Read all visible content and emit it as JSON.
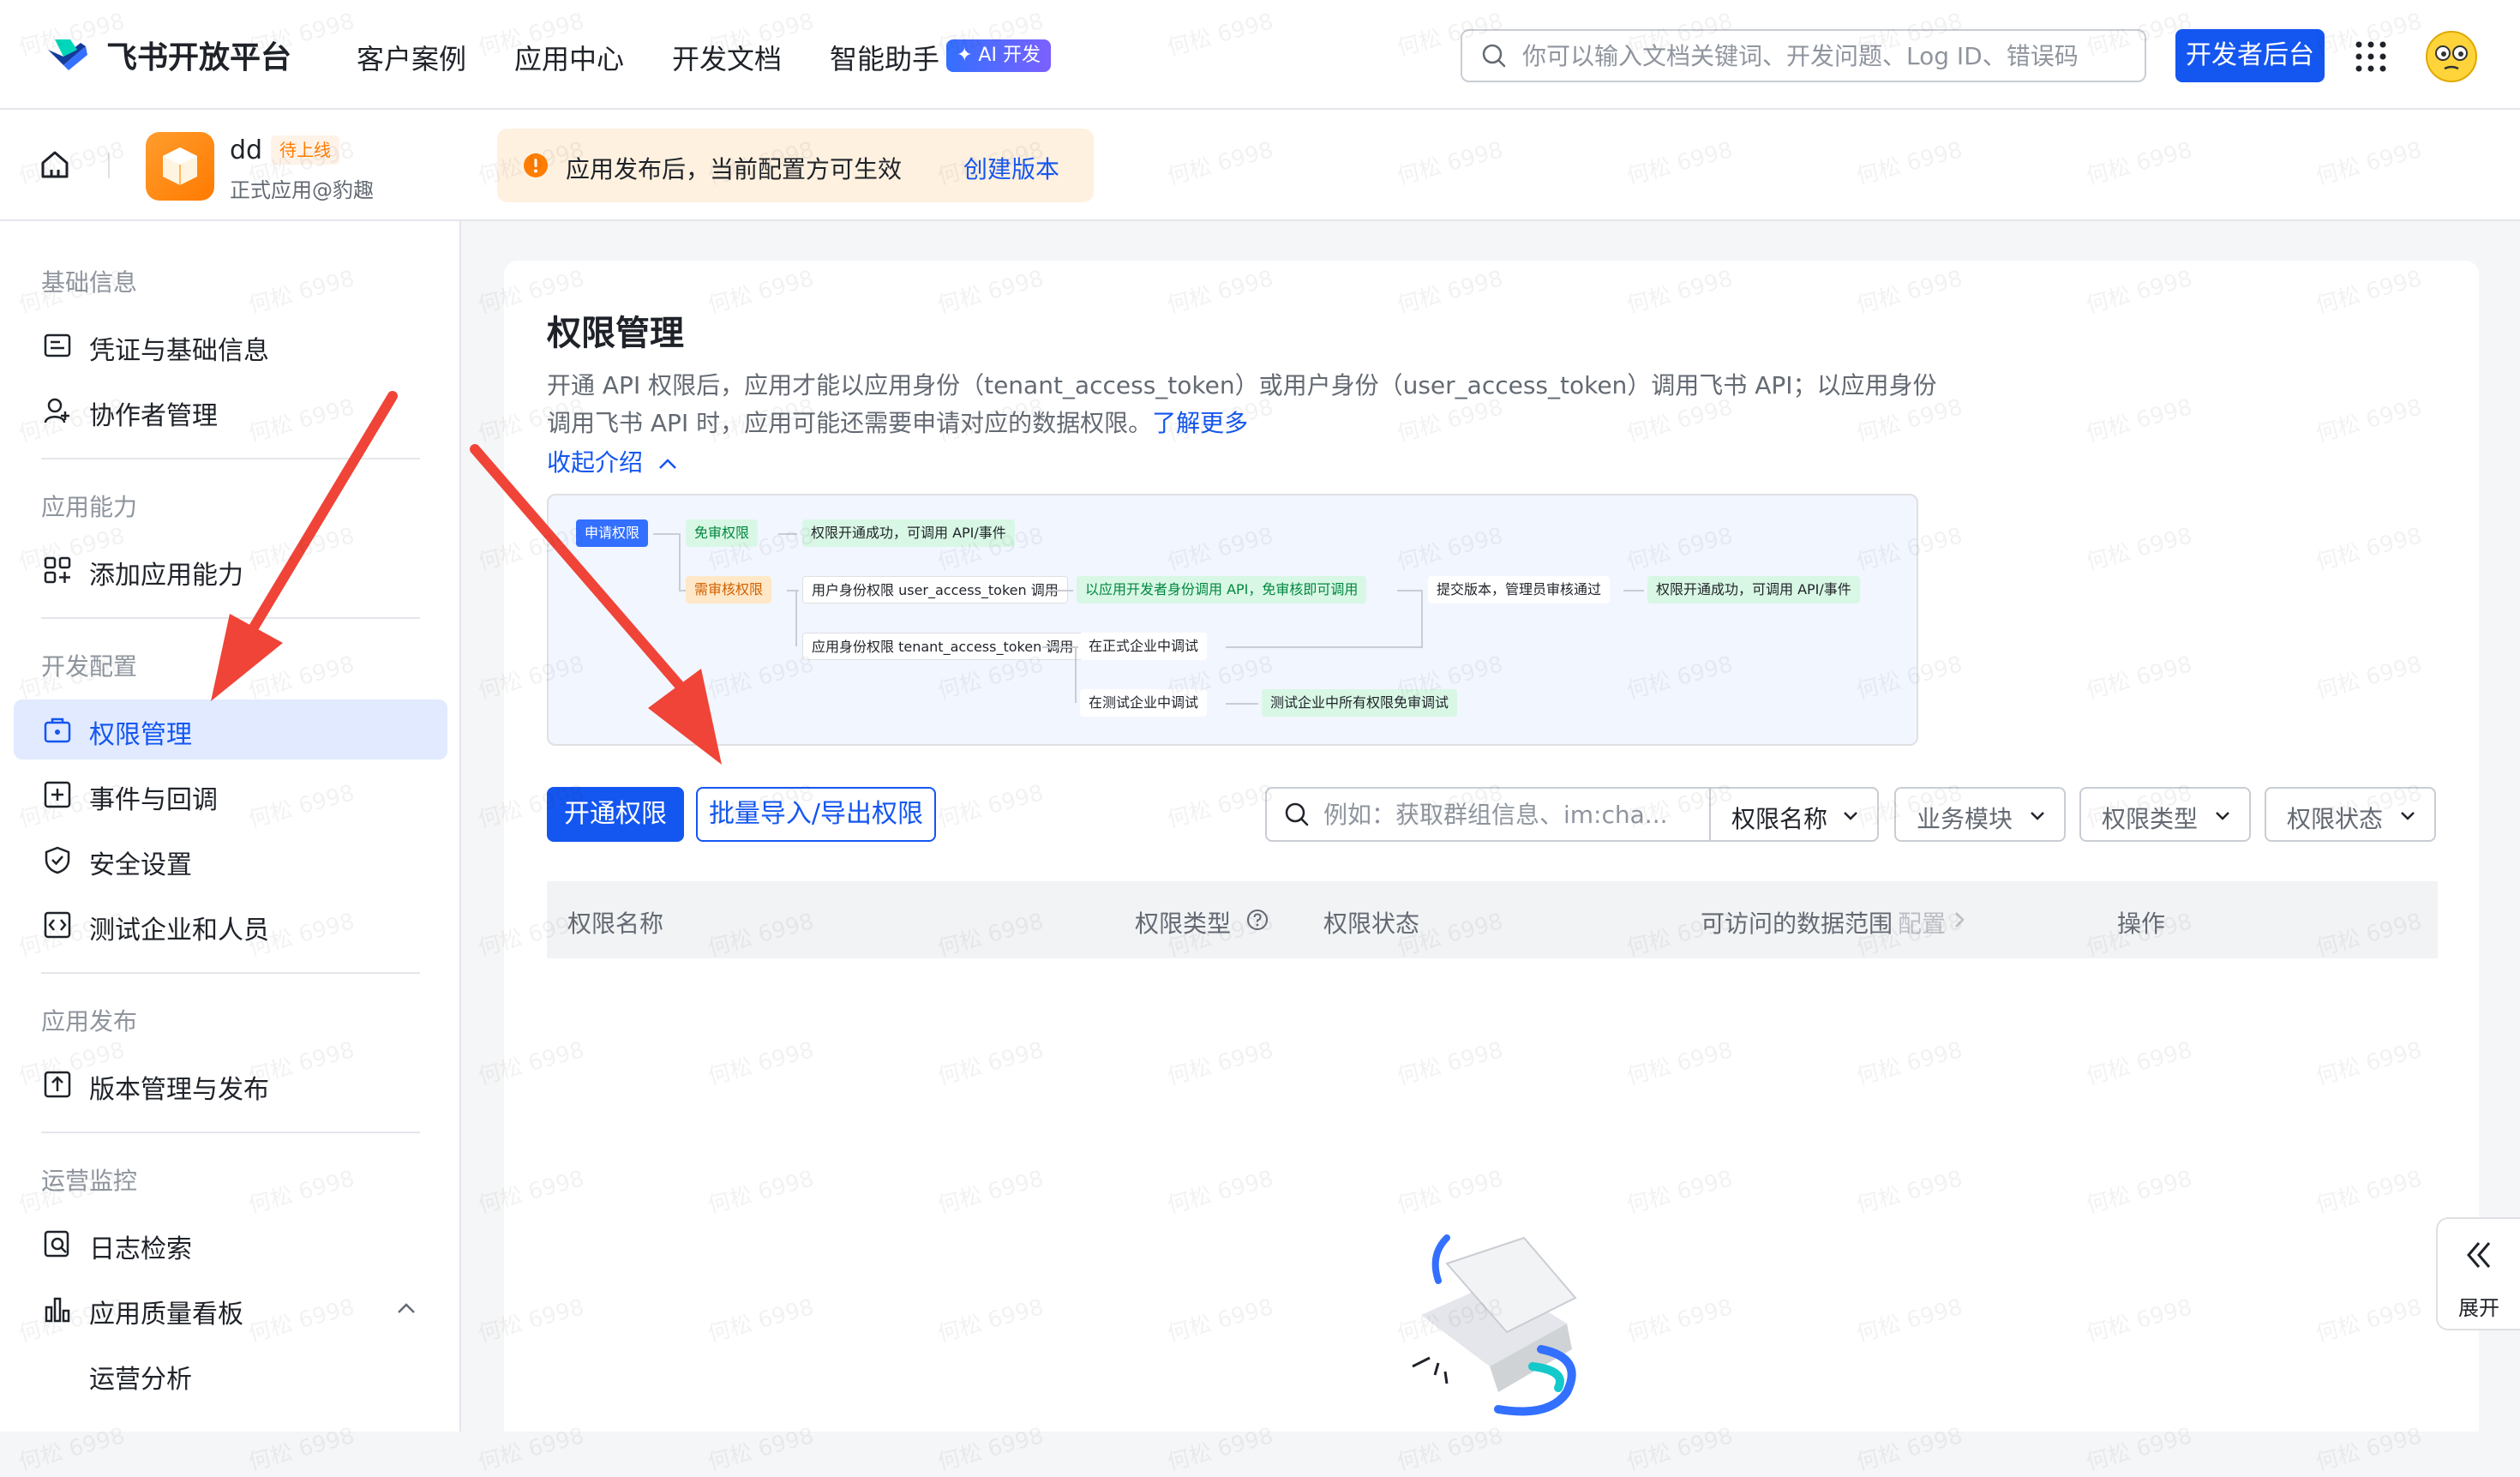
{
  "brand": {
    "name": "飞书开放平台"
  },
  "nav": {
    "items": [
      "客户案例",
      "应用中心",
      "开发文档",
      "智能助手"
    ],
    "ai_badge": "✦ AI 开发"
  },
  "search": {
    "placeholder": "你可以输入文档关键词、开发问题、Log ID、错误码"
  },
  "dev_button": "开发者后台",
  "app": {
    "name": "dd",
    "status": "待上线",
    "subtitle": "正式应用@豹趣"
  },
  "notice": {
    "text": "应用发布后，当前配置方可生效",
    "link": "创建版本"
  },
  "sidebar": {
    "sections": [
      {
        "title": "基础信息",
        "items": [
          {
            "label": "凭证与基础信息",
            "icon": "credential-icon"
          },
          {
            "label": "协作者管理",
            "icon": "user-add-icon"
          }
        ]
      },
      {
        "title": "应用能力",
        "items": [
          {
            "label": "添加应用能力",
            "icon": "grid-add-icon"
          }
        ]
      },
      {
        "title": "开发配置",
        "items": [
          {
            "label": "权限管理",
            "icon": "permission-icon",
            "active": true
          },
          {
            "label": "事件与回调",
            "icon": "event-icon"
          },
          {
            "label": "安全设置",
            "icon": "shield-icon"
          },
          {
            "label": "测试企业和人员",
            "icon": "test-icon"
          }
        ]
      },
      {
        "title": "应用发布",
        "items": [
          {
            "label": "版本管理与发布",
            "icon": "upload-icon"
          }
        ]
      },
      {
        "title": "运营监控",
        "items": [
          {
            "label": "日志检索",
            "icon": "log-search-icon"
          },
          {
            "label": "应用质量看板",
            "icon": "bar-chart-icon"
          }
        ]
      }
    ],
    "sub_items": [
      "运营分析"
    ]
  },
  "main": {
    "title": "权限管理",
    "description_1": "开通 API 权限后，应用才能以应用身份（tenant_access_token）或用户身份（user_access_token）调用飞书 API；以应用身份",
    "description_2": "调用飞书 API 时，应用可能还需要申请对应的数据权限。",
    "learn_more": "了解更多",
    "collapse": "收起介绍",
    "flow": {
      "apply": "申请权限",
      "no_review": "免审权限",
      "no_review_result": "权限开通成功，可调用 API/事件",
      "need_review": "需审核权限",
      "user_identity": "用户身份权限 user_access_token 调用",
      "dev_identity": "以应用开发者身份调用 API，免审核即可调用",
      "submit": "提交版本，管理员审核通过",
      "review_result": "权限开通成功，可调用 API/事件",
      "app_identity": "应用身份权限 tenant_access_token 调用",
      "prod_debug": "在正式企业中调试",
      "test_debug": "在测试企业中调试",
      "test_result": "测试企业中所有权限免审调试"
    },
    "buttons": {
      "enable": "开通权限",
      "batch": "批量导入/导出权限"
    },
    "filter": {
      "placeholder": "例如：获取群组信息、im:cha...",
      "selects": [
        "权限名称",
        "业务模块",
        "权限类型",
        "权限状态"
      ]
    },
    "table": {
      "columns": [
        "权限名称",
        "权限类型",
        "权限状态",
        "可访问的数据范围",
        "操作"
      ],
      "configure": "配置"
    }
  },
  "expand_label": "展开",
  "watermark": "何松 6998",
  "colors": {
    "primary": "#1456f0",
    "arrow": "#f04438",
    "active_bg": "#e1eaff"
  }
}
